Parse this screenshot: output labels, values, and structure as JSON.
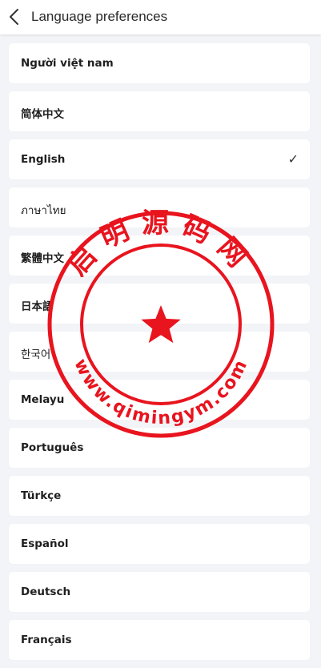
{
  "header": {
    "title": "Language preferences",
    "back_icon": "chevron-left-icon"
  },
  "languages": [
    {
      "label": "Người việt nam",
      "selected": false
    },
    {
      "label": "简体中文",
      "selected": false
    },
    {
      "label": "English",
      "selected": true
    },
    {
      "label": "ภาษาไทย",
      "selected": false
    },
    {
      "label": "繁體中文",
      "selected": false
    },
    {
      "label": "日本語",
      "selected": false
    },
    {
      "label": "한국어",
      "selected": false
    },
    {
      "label": "Melayu",
      "selected": false
    },
    {
      "label": "Português",
      "selected": false
    },
    {
      "label": "Türkçe",
      "selected": false
    },
    {
      "label": "Español",
      "selected": false
    },
    {
      "label": "Deutsch",
      "selected": false
    },
    {
      "label": "Français",
      "selected": false
    }
  ],
  "check_mark": "✓",
  "watermark": {
    "top_text": "启明源码网",
    "bottom_text": "www.qimingym.com",
    "color": "#e8141e",
    "icon": "star-icon"
  }
}
